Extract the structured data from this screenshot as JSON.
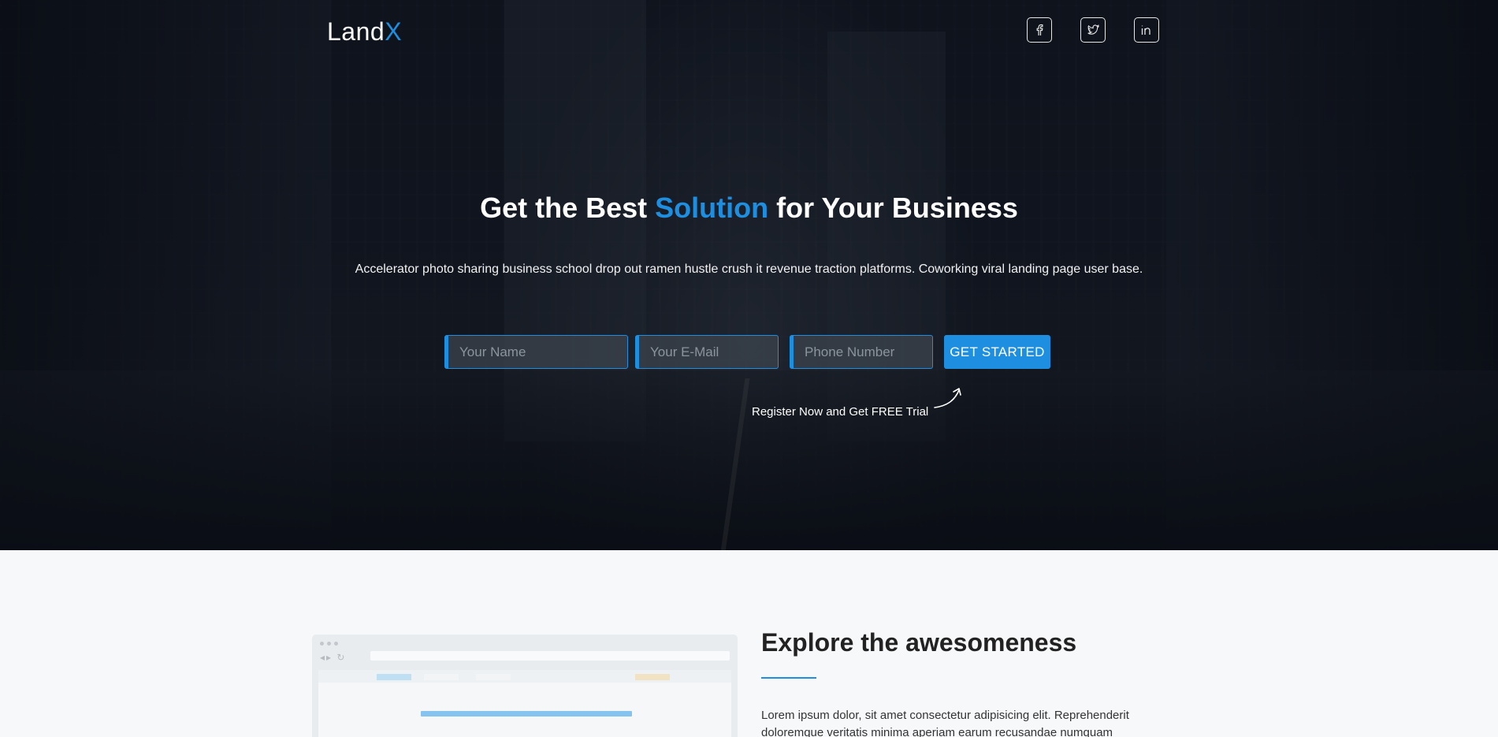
{
  "brand": {
    "name_main": "Land",
    "name_accent": "X"
  },
  "social": [
    {
      "name": "facebook",
      "glyph": "f"
    },
    {
      "name": "twitter",
      "glyph": "t"
    },
    {
      "name": "linkedin",
      "glyph": "in"
    }
  ],
  "hero": {
    "headline_part1": "Get the Best ",
    "headline_accent": "Solution",
    "headline_part2": " for Your ",
    "headline_strong": "Business",
    "subtext": "Accelerator photo sharing business school drop out ramen hustle crush it revenue traction platforms. Coworking viral landing page user base.",
    "form": {
      "name_placeholder": "Your Name",
      "email_placeholder": "Your E-Mail",
      "phone_placeholder": "Phone Number",
      "cta_label": "GET STARTED"
    },
    "register_text": "Register Now and Get FREE Trial"
  },
  "section2": {
    "title": "Explore the awesomeness",
    "body": "Lorem ipsum dolor, sit amet consectetur adipisicing elit. Reprehenderit doloremque veritatis minima aperiam earum recusandae numquam"
  },
  "colors": {
    "accent": "#1e8fe0",
    "hero_dark": "#161d27",
    "section_bg": "#f6f8fa"
  }
}
